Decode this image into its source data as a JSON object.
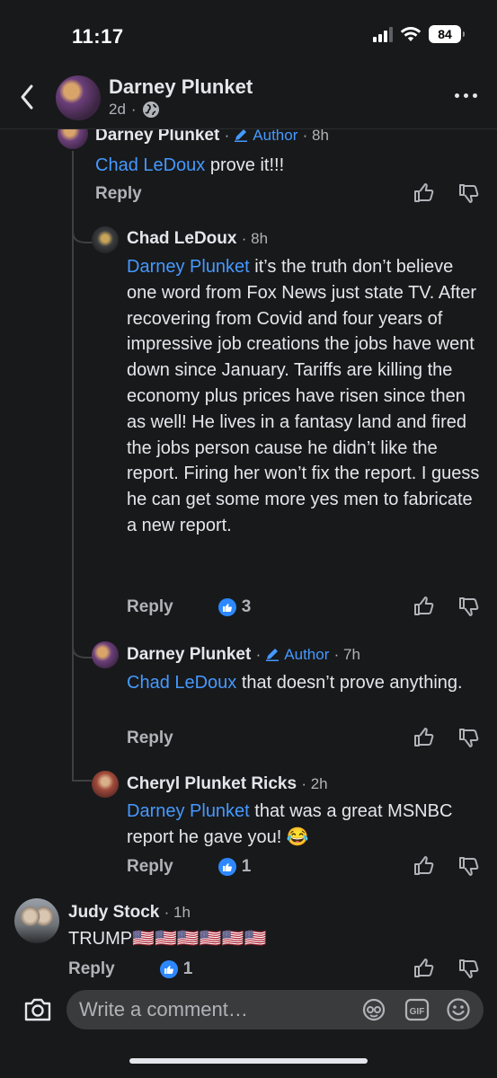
{
  "status_bar": {
    "time": "11:17",
    "battery": "84"
  },
  "header": {
    "name": "Darney Plunket",
    "age": "2d"
  },
  "comments": [
    {
      "name": "Darney Plunket",
      "author_label": "Author",
      "age": "8h",
      "mention": "Chad LeDoux",
      "text": " prove it!!!",
      "reply": "Reply"
    },
    {
      "name": "Chad LeDoux",
      "age": "8h",
      "mention": "Darney Plunket",
      "text": " it’s the truth don’t believe one word from Fox News just state TV. After recovering from Covid and four years of impressive job creations the jobs have went down since January. Tariffs are killing the economy plus prices have risen since then as well! He lives in a fantasy land and fired the jobs person cause he didn’t like the report. Firing her won’t fix the report. I guess he can get some more yes men to fabricate a new report.",
      "reply": "Reply",
      "likes": "3"
    },
    {
      "name": "Darney Plunket",
      "author_label": "Author",
      "age": "7h",
      "mention": "Chad LeDoux",
      "text": " that doesn’t prove anything.",
      "reply": "Reply"
    },
    {
      "name": "Cheryl Plunket Ricks",
      "age": "2h",
      "mention": "Darney Plunket",
      "text": " that was a great MSNBC report he gave you! 😂",
      "reply": "Reply",
      "likes": "1"
    },
    {
      "name": "Judy Stock",
      "age": "1h",
      "text": "TRUMP🇺🇸🇺🇸🇺🇸🇺🇸🇺🇸🇺🇸",
      "reply": "Reply",
      "likes": "1"
    }
  ],
  "composer": {
    "placeholder": "Write a comment…"
  }
}
